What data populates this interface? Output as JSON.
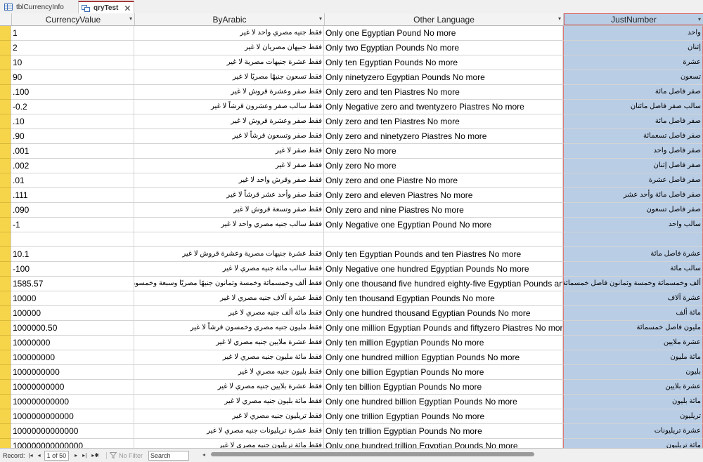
{
  "tabs": [
    {
      "label": "tblCurrencyInfo",
      "icon": "table-icon"
    },
    {
      "label": "qryTest",
      "icon": "query-icon"
    }
  ],
  "columns": [
    "CurrencyValue",
    "ByArabic",
    "Other Language",
    "JustNumber"
  ],
  "rows": [
    [
      "1",
      "فقط جنيه مصري واحد لا غير",
      "Only one Egyptian Pound No more",
      "واحد"
    ],
    [
      "2",
      "فقط جنيهان مصريان لا غير",
      "Only two Egyptian Pounds No more",
      "إثنان"
    ],
    [
      "10",
      "فقط عشرة جنيهات مصرية لا غير",
      "Only ten Egyptian Pounds No more",
      "عشرة"
    ],
    [
      "90",
      "فقط تسعون جنيهًا مصريًا لا غير",
      "Only ninetyzero Egyptian Pounds No more",
      "تسعون"
    ],
    [
      ".100",
      "فقط صفر وعشرة قروش لا غير",
      "Only zero and ten Piastres No more",
      "صفر فاصل مائة"
    ],
    [
      "-0.2",
      "فقط سالب صفر وعشرون قرشاً لا غير",
      "Only Negative zero and twentyzero Piastres No more",
      "سالب صفر فاصل مائتان"
    ],
    [
      ".10",
      "فقط صفر وعشرة قروش لا غير",
      "Only zero and ten Piastres No more",
      "صفر فاصل مائة"
    ],
    [
      ".90",
      "فقط صفر وتسعون قرشاً لا غير",
      "Only zero and ninetyzero Piastres No more",
      "صفر فاصل تسعمائة"
    ],
    [
      ".001",
      "فقط صفر لا غير",
      "Only zero No more",
      "صفر فاصل واحد"
    ],
    [
      ".002",
      "فقط صفر لا غير",
      "Only zero No more",
      "صفر فاصل إثنان"
    ],
    [
      ".01",
      "فقط صفر وقرش واحد لا غير",
      "Only zero and one Piastre No more",
      "صفر فاصل عشرة"
    ],
    [
      ".111",
      "فقط صفر وأحد عشر قرشاً لا غير",
      "Only zero and eleven Piastres No more",
      "صفر فاصل مائة وأحد عشر"
    ],
    [
      ".090",
      "فقط صفر وتسعة قروش لا غير",
      "Only zero and nine Piastres No more",
      "صفر فاصل تسعون"
    ],
    [
      "-1",
      "فقط سالب جنيه مصري واحد لا غير",
      "Only Negative one Egyptian Pound No more",
      "سالب واحد"
    ],
    [
      "",
      "",
      "",
      ""
    ],
    [
      "10.1",
      "فقط عشرة جنيهات مصرية وعشرة قروش لا غير",
      "Only ten Egyptian Pounds and ten Piastres No more",
      "عشرة فاصل مائة"
    ],
    [
      "-100",
      "فقط سالب مائة جنيه مصري لا غير",
      "Only Negative one hundred Egyptian Pounds No more",
      "سالب مائة"
    ],
    [
      "1585.57",
      "فقط ألف وخمسمائة وخمسة وثمانون جنيهًا مصريًا وسبعة وخمسون قرشاً",
      "Only one thousand five hundred eighty-five Egyptian Pounds and fifty-seven",
      "ألف وخمسمائة وخمسة وثمانون فاصل خمسمائة وسبعون"
    ],
    [
      "10000",
      "فقط عشرة آلاف جنيه مصري لا غير",
      "Only ten thousand Egyptian Pounds No more",
      "عشرة آلاف"
    ],
    [
      "100000",
      "فقط مائة ألف جنيه مصري لا غير",
      "Only one hundred thousand Egyptian Pounds No more",
      "مائة ألف"
    ],
    [
      "1000000.50",
      "فقط مليون جنيه مصري وخمسون قرشاً لا غير",
      "Only one million Egyptian Pounds and fiftyzero Piastres No more",
      "مليون فاصل خمسمائة"
    ],
    [
      "10000000",
      "فقط عشرة ملايين جنيه مصري لا غير",
      "Only ten million Egyptian Pounds No more",
      "عشرة ملايين"
    ],
    [
      "100000000",
      "فقط مائة مليون جنيه مصري لا غير",
      "Only one hundred million Egyptian Pounds No more",
      "مائة مليون"
    ],
    [
      "1000000000",
      "فقط بليون جنيه مصري لا غير",
      "Only one billion Egyptian Pounds No more",
      "بليون"
    ],
    [
      "10000000000",
      "فقط عشرة بلايين جنيه مصري لا غير",
      "Only ten billion Egyptian Pounds No more",
      "عشرة بلايين"
    ],
    [
      "100000000000",
      "فقط مائة بليون جنيه مصري لا غير",
      "Only one hundred billion Egyptian Pounds No more",
      "مائة بليون"
    ],
    [
      "1000000000000",
      "فقط تريليون جنيه مصري لا غير",
      "Only one trillion Egyptian Pounds No more",
      "تريليون"
    ],
    [
      "10000000000000",
      "فقط عشرة تريليونات جنيه مصري لا غير",
      "Only ten trillion Egyptian Pounds No more",
      "عشرة تريليونات"
    ],
    [
      "100000000000000",
      "فقط مائة تريليون جنيه مصري لا غير",
      "Only one hundred trillion Egyptian Pounds No more",
      "مائة تريليون"
    ]
  ],
  "status": {
    "record_label": "Record:",
    "record_position": "1 of 50",
    "filter_label": "No Filter",
    "search_label": "Search"
  },
  "colors": {
    "record_selector": "#f7d54a",
    "selected_column": "#b9cde5",
    "active_tab_accent": "#a4373a"
  }
}
